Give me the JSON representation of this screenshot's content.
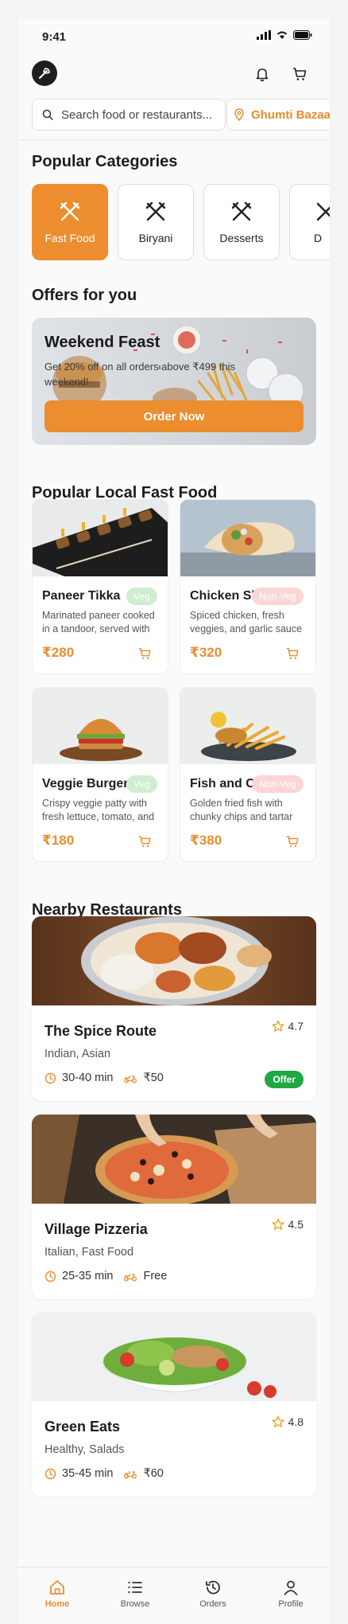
{
  "status_bar": {
    "time": "9:41"
  },
  "search": {
    "placeholder": "Search food or restaurants...",
    "location": "Ghumti Bazaar"
  },
  "sections": {
    "categories": "Popular Categories",
    "offers": "Offers for you",
    "fast_food": "Popular Local Fast Food",
    "nearby": "Nearby Restaurants"
  },
  "categories": [
    {
      "label": "Fast Food",
      "active": true
    },
    {
      "label": "Biryani",
      "active": false
    },
    {
      "label": "Desserts",
      "active": false
    },
    {
      "label": "D",
      "active": false
    }
  ],
  "offer": {
    "title": "Weekend Feast",
    "subtitle": "Get 20% off on all orders above ₹499 this weekend!",
    "button": "Order Now"
  },
  "foods": [
    {
      "name": "Paneer Tikka",
      "badge": "Veg",
      "desc": "Marinated paneer cooked in a tandoor, served with",
      "price": "₹280"
    },
    {
      "name": "Chicken Sh",
      "badge": "Non-Veg",
      "desc": "Spiced chicken, fresh veggies, and garlic sauce",
      "price": "₹320"
    },
    {
      "name": "Veggie Burger",
      "badge": "Veg",
      "desc": "Crispy veggie patty with fresh lettuce, tomato, and",
      "price": "₹180"
    },
    {
      "name": "Fish and Cl",
      "badge": "Non-Veg",
      "desc": "Golden fried fish with chunky chips and tartar",
      "price": "₹380"
    }
  ],
  "restaurants": [
    {
      "name": "The Spice Route",
      "rating": "4.7",
      "cuisine": "Indian, Asian",
      "time": "30-40 min",
      "fee": "₹50",
      "badge": "Offer"
    },
    {
      "name": "Village Pizzeria",
      "rating": "4.5",
      "cuisine": "Italian, Fast Food",
      "time": "25-35 min",
      "fee": "Free"
    },
    {
      "name": "Green Eats",
      "rating": "4.8",
      "cuisine": "Healthy, Salads",
      "time": "35-45 min",
      "fee": "₹60"
    }
  ],
  "nav": [
    {
      "label": "Home",
      "active": true
    },
    {
      "label": "Browse",
      "active": false
    },
    {
      "label": "Orders",
      "active": false
    },
    {
      "label": "Profile",
      "active": false
    }
  ],
  "colors": {
    "accent": "#ec8d2f",
    "offer_green": "#1fa743",
    "veg_badge": "#cdeecf",
    "nonveg_badge": "#fbd6d6"
  }
}
